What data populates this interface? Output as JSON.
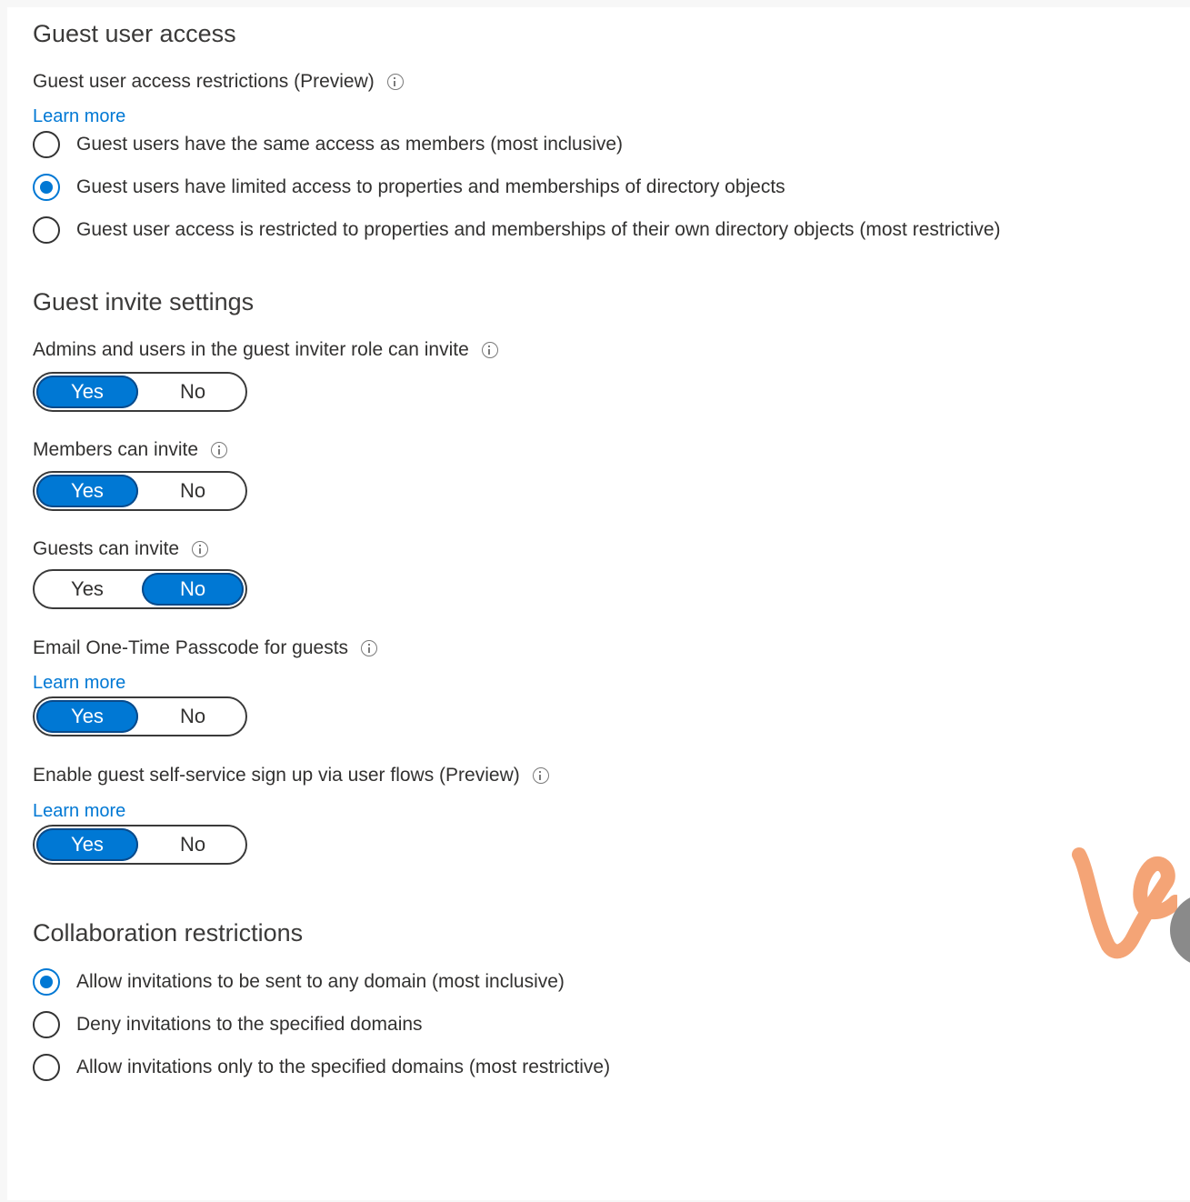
{
  "guest_user_access": {
    "title": "Guest user access",
    "restrictions_label": "Guest user access restrictions (Preview)",
    "learn_more": "Learn more",
    "options": [
      {
        "label": "Guest users have the same access as members (most inclusive)",
        "selected": false
      },
      {
        "label": "Guest users have limited access to properties and memberships of directory objects",
        "selected": true
      },
      {
        "label": "Guest user access is restricted to properties and memberships of their own directory objects (most restrictive)",
        "selected": false
      }
    ]
  },
  "guest_invite_settings": {
    "title": "Guest invite settings",
    "toggles": [
      {
        "label": "Admins and users in the guest inviter role can invite",
        "yes": "Yes",
        "no": "No",
        "value": "Yes"
      },
      {
        "label": "Members can invite",
        "yes": "Yes",
        "no": "No",
        "value": "Yes"
      },
      {
        "label": "Guests can invite",
        "yes": "Yes",
        "no": "No",
        "value": "No"
      },
      {
        "label": "Email One-Time Passcode for guests",
        "learn_more": "Learn more",
        "yes": "Yes",
        "no": "No",
        "value": "Yes"
      },
      {
        "label": "Enable guest self-service sign up via user flows (Preview)",
        "learn_more": "Learn more",
        "yes": "Yes",
        "no": "No",
        "value": "Yes"
      }
    ]
  },
  "collaboration_restrictions": {
    "title": "Collaboration restrictions",
    "options": [
      {
        "label": "Allow invitations to be sent to any domain (most inclusive)",
        "selected": true
      },
      {
        "label": "Deny invitations to the specified domains",
        "selected": false
      },
      {
        "label": "Allow invitations only to the specified domains (most restrictive)",
        "selected": false
      }
    ]
  },
  "colors": {
    "accent": "#0078d4",
    "logo": "#f4a476"
  }
}
